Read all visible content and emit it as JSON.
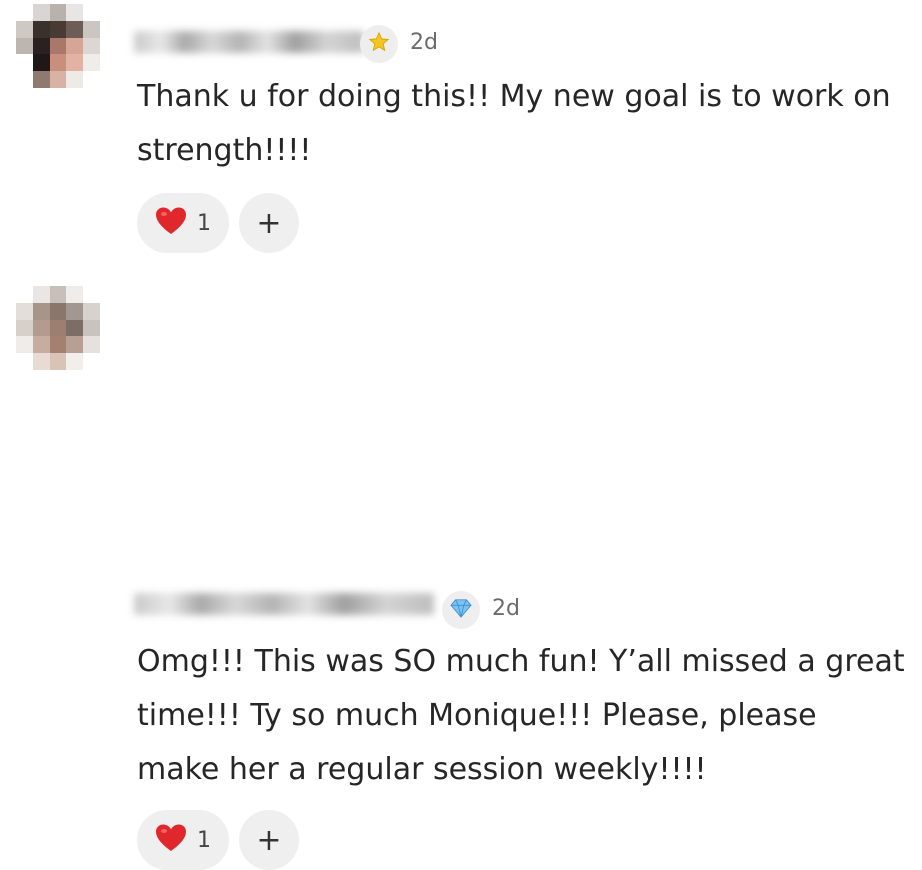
{
  "comments": [
    {
      "badge_icon": "star-icon",
      "time": "2d",
      "text": "Thank u for doing this!! My new goal is to work on strength!!!!",
      "reaction": {
        "icon": "heart-icon",
        "count": "1"
      },
      "add_reaction_label": "+"
    },
    {
      "badge_icon": "diamond-icon",
      "time": "2d",
      "text": "Omg!!! This was SO much fun! Y’all missed a great time!!! Ty so much Monique!!! Please, please make her a regular session weekly!!!!",
      "reaction": {
        "icon": "heart-icon",
        "count": "1"
      },
      "add_reaction_label": "+"
    }
  ],
  "colors": {
    "heart": "#e0272b",
    "star": "#f3c623",
    "diamond": "#5aa9e6",
    "pill_bg": "#efefef"
  }
}
